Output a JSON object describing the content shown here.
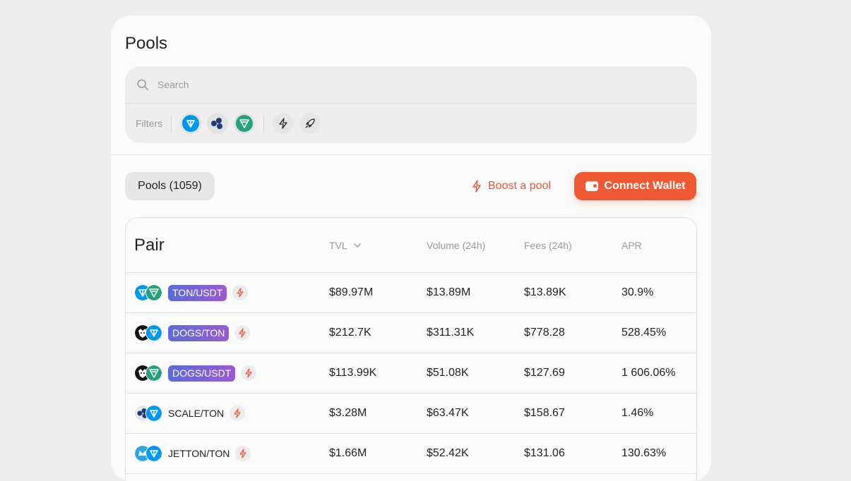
{
  "page": {
    "title": "Pools"
  },
  "search": {
    "placeholder": "Search"
  },
  "filters": {
    "label": "Filters",
    "chips": [
      "ton-icon",
      "scale-icon",
      "usdt-icon",
      "bolt-icon",
      "rocket-icon"
    ]
  },
  "toolbar": {
    "pools_tab": "Pools (1059)",
    "boost_label": "Boost a pool",
    "connect_label": "Connect Wallet"
  },
  "table": {
    "headers": {
      "pair": "Pair",
      "tvl": "TVL",
      "volume": "Volume (24h)",
      "fees": "Fees (24h)",
      "apr": "APR"
    },
    "rows": [
      {
        "pair": "TON/USDT",
        "tvl": "$89.97M",
        "volume": "$13.89M",
        "fees": "$13.89K",
        "apr": "30.9%"
      },
      {
        "pair": "DOGS/TON",
        "tvl": "$212.7K",
        "volume": "$311.31K",
        "fees": "$778.28",
        "apr": "528.45%"
      },
      {
        "pair": "DOGS/USDT",
        "tvl": "$113.99K",
        "volume": "$51.08K",
        "fees": "$127.69",
        "apr": "1 606.06%"
      },
      {
        "pair": "SCALE/TON",
        "tvl": "$3.28M",
        "volume": "$63.47K",
        "fees": "$158.67",
        "apr": "1.46%"
      },
      {
        "pair": "JETTON/TON",
        "tvl": "$1.66M",
        "volume": "$52.42K",
        "fees": "$131.06",
        "apr": "130.63%"
      }
    ]
  },
  "colors": {
    "accent": "#ef5a34",
    "ton": "#0098ea",
    "usdt": "#26a17b",
    "tag_start": "#5b6bd9",
    "tag_end": "#9b5bd0"
  }
}
